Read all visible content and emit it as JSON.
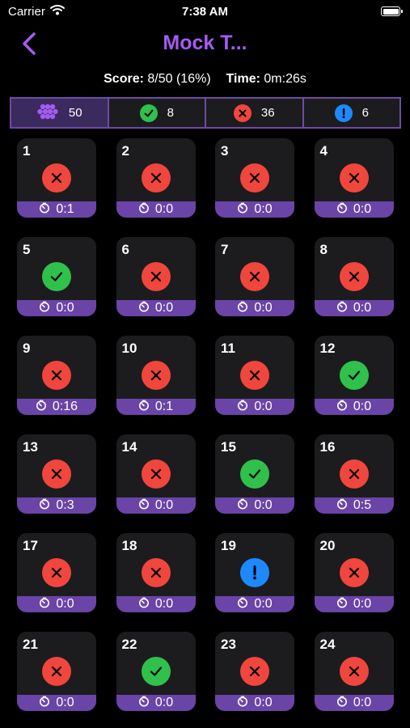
{
  "status_bar": {
    "carrier": "Carrier",
    "time": "7:38 AM"
  },
  "nav": {
    "title": "Mock T..."
  },
  "summary": {
    "score_label": "Score:",
    "score_value": "8/50 (16%)",
    "time_label": "Time:",
    "time_value": "0m:26s"
  },
  "filters": {
    "all": {
      "count": "50",
      "icon": "grid-dots-icon"
    },
    "correct": {
      "count": "8",
      "icon": "check-circle-icon"
    },
    "wrong": {
      "count": "36",
      "icon": "x-circle-icon"
    },
    "skipped": {
      "count": "6",
      "icon": "exclamation-circle-icon"
    }
  },
  "colors": {
    "accent": "#a55bf3",
    "time_bar": "#6b44a8",
    "correct": "#2fc14b",
    "wrong": "#f0463d",
    "skipped": "#1e88ff",
    "card": "#1c1c1e"
  },
  "questions": [
    {
      "number": "1",
      "status": "wrong",
      "time": "0:1"
    },
    {
      "number": "2",
      "status": "wrong",
      "time": "0:0"
    },
    {
      "number": "3",
      "status": "wrong",
      "time": "0:0"
    },
    {
      "number": "4",
      "status": "wrong",
      "time": "0:0"
    },
    {
      "number": "5",
      "status": "correct",
      "time": "0:0"
    },
    {
      "number": "6",
      "status": "wrong",
      "time": "0:0"
    },
    {
      "number": "7",
      "status": "wrong",
      "time": "0:0"
    },
    {
      "number": "8",
      "status": "wrong",
      "time": "0:0"
    },
    {
      "number": "9",
      "status": "wrong",
      "time": "0:16"
    },
    {
      "number": "10",
      "status": "wrong",
      "time": "0:1"
    },
    {
      "number": "11",
      "status": "wrong",
      "time": "0:0"
    },
    {
      "number": "12",
      "status": "correct",
      "time": "0:0"
    },
    {
      "number": "13",
      "status": "wrong",
      "time": "0:3"
    },
    {
      "number": "14",
      "status": "wrong",
      "time": "0:0"
    },
    {
      "number": "15",
      "status": "correct",
      "time": "0:0"
    },
    {
      "number": "16",
      "status": "wrong",
      "time": "0:5"
    },
    {
      "number": "17",
      "status": "wrong",
      "time": "0:0"
    },
    {
      "number": "18",
      "status": "wrong",
      "time": "0:0"
    },
    {
      "number": "19",
      "status": "skipped",
      "time": "0:0"
    },
    {
      "number": "20",
      "status": "wrong",
      "time": "0:0"
    },
    {
      "number": "21",
      "status": "wrong",
      "time": "0:0"
    },
    {
      "number": "22",
      "status": "correct",
      "time": "0:0"
    },
    {
      "number": "23",
      "status": "wrong",
      "time": "0:0"
    },
    {
      "number": "24",
      "status": "wrong",
      "time": "0:0"
    }
  ]
}
